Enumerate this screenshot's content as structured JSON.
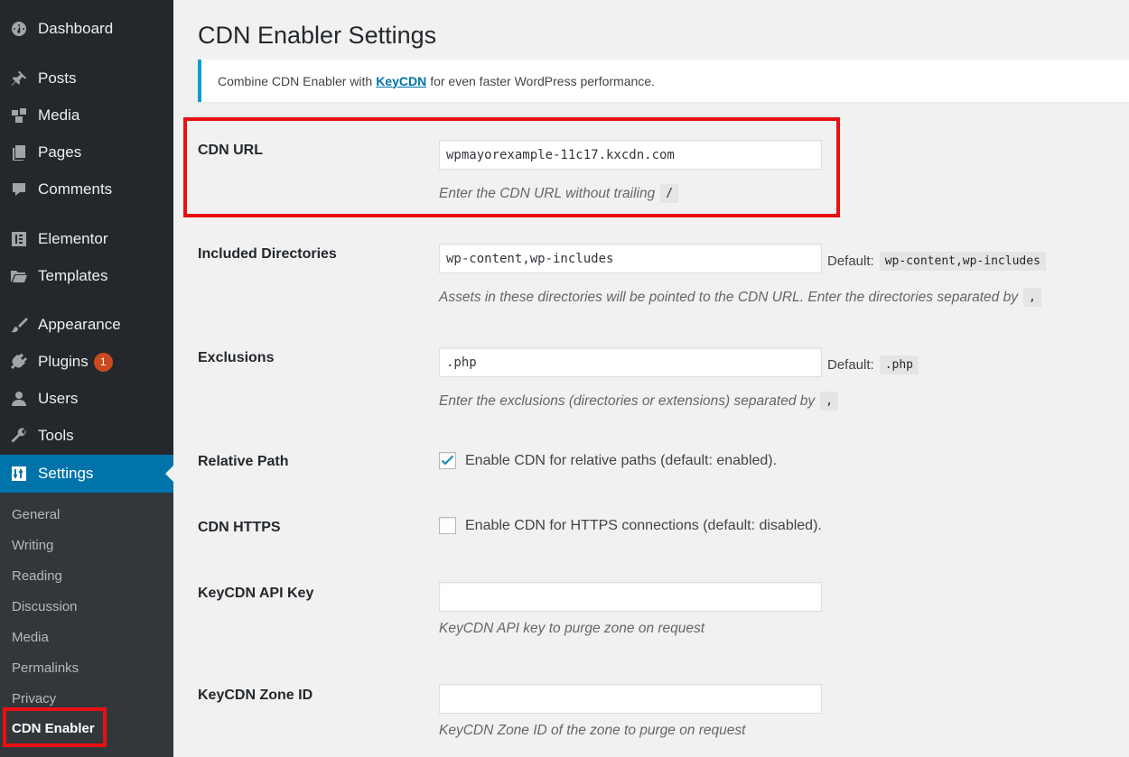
{
  "sidebar": {
    "items": [
      {
        "id": "dashboard",
        "label": "Dashboard",
        "icon": "dashboard-icon"
      },
      {
        "id": "posts",
        "label": "Posts",
        "icon": "pin-icon"
      },
      {
        "id": "media",
        "label": "Media",
        "icon": "media-icon"
      },
      {
        "id": "pages",
        "label": "Pages",
        "icon": "pages-icon"
      },
      {
        "id": "comments",
        "label": "Comments",
        "icon": "comment-icon"
      },
      {
        "id": "elementor",
        "label": "Elementor",
        "icon": "elementor-icon"
      },
      {
        "id": "templates",
        "label": "Templates",
        "icon": "folder-icon"
      },
      {
        "id": "appearance",
        "label": "Appearance",
        "icon": "brush-icon"
      },
      {
        "id": "plugins",
        "label": "Plugins",
        "icon": "plug-icon",
        "badge": "1"
      },
      {
        "id": "users",
        "label": "Users",
        "icon": "user-icon"
      },
      {
        "id": "tools",
        "label": "Tools",
        "icon": "wrench-icon"
      },
      {
        "id": "settings",
        "label": "Settings",
        "icon": "settings-icon"
      }
    ],
    "submenu": [
      "General",
      "Writing",
      "Reading",
      "Discussion",
      "Media",
      "Permalinks",
      "Privacy",
      "CDN Enabler"
    ]
  },
  "page": {
    "title": "CDN Enabler Settings",
    "notice": {
      "before": "Combine CDN Enabler with",
      "link": "KeyCDN",
      "after": "for even faster WordPress performance."
    }
  },
  "fields": {
    "cdn_url": {
      "label": "CDN URL",
      "value": "wpmayorexample-11c17.kxcdn.com",
      "desc": "Enter the CDN URL without trailing",
      "desc_code": "/"
    },
    "included_dirs": {
      "label": "Included Directories",
      "value": "wp-content,wp-includes",
      "default_label": "Default:",
      "default_value": "wp-content,wp-includes",
      "desc": "Assets in these directories will be pointed to the CDN URL. Enter the directories separated by",
      "desc_code": ","
    },
    "exclusions": {
      "label": "Exclusions",
      "value": ".php",
      "default_label": "Default:",
      "default_value": ".php",
      "desc": "Enter the exclusions (directories or extensions) separated by",
      "desc_code": ","
    },
    "relative_path": {
      "label": "Relative Path",
      "checkbox_label": "Enable CDN for relative paths (default: enabled).",
      "checked": true
    },
    "cdn_https": {
      "label": "CDN HTTPS",
      "checkbox_label": "Enable CDN for HTTPS connections (default: disabled).",
      "checked": false
    },
    "api_key": {
      "label": "KeyCDN API Key",
      "value": "",
      "desc": "KeyCDN API key to purge zone on request"
    },
    "zone_id": {
      "label": "KeyCDN Zone ID",
      "value": "",
      "desc": "KeyCDN Zone ID of the zone to purge on request"
    }
  },
  "colors": {
    "sidebar_bg": "#23282d",
    "submenu_bg": "#32373c",
    "active_blue": "#0073aa",
    "notice_border": "#00a0d2",
    "highlight_red": "#e81010",
    "badge_orange": "#ca4a1f"
  }
}
